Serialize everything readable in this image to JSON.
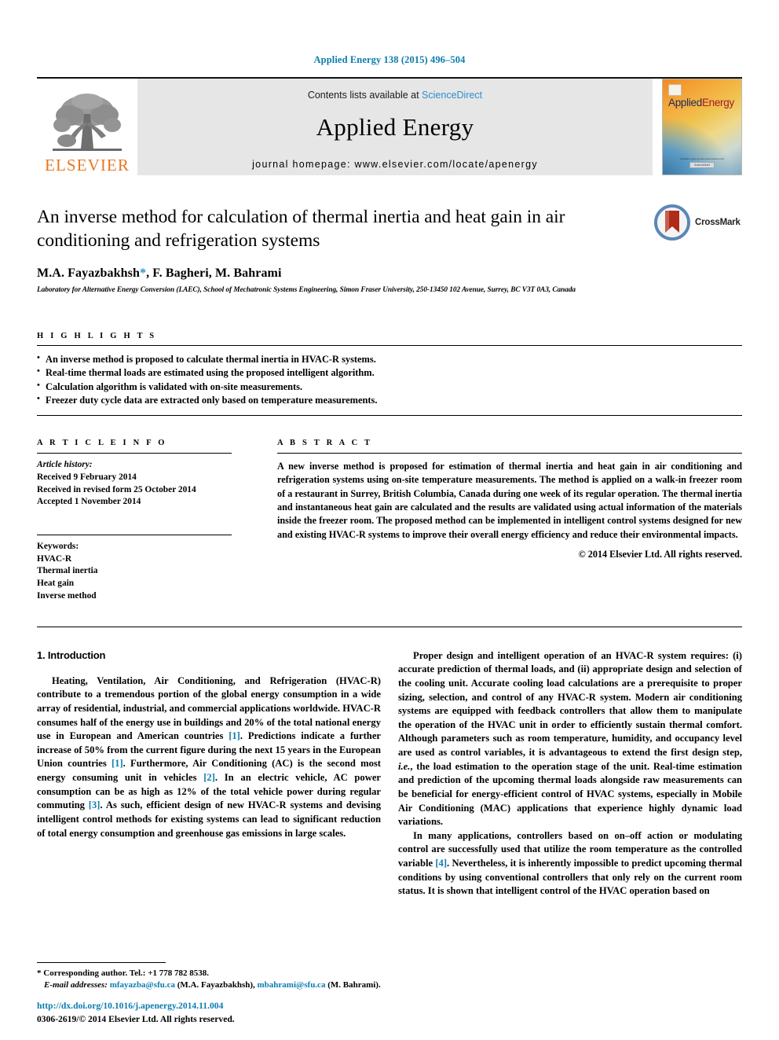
{
  "running_head": "Applied Energy 138 (2015) 496–504",
  "masthead": {
    "publisher_logo_text": "ELSEVIER",
    "contents_prefix": "Contents lists available at ",
    "contents_link": "ScienceDirect",
    "journal_name": "Applied Energy",
    "homepage": "journal homepage: www.elsevier.com/locate/apenergy",
    "cover": {
      "title_part1": "Applied",
      "title_part2": "Energy",
      "footer_caption": "Available online at www.sciencedirect.com",
      "footer_badge": "ScienceDirect"
    }
  },
  "article": {
    "title": "An inverse method for calculation of thermal inertia and heat gain in air conditioning and refrigeration systems",
    "authors": "M.A. Fayazbakhsh",
    "corresponding_marker": "*",
    "authors_rest": ", F. Bagheri, M. Bahrami",
    "affiliation": "Laboratory for Alternative Energy Conversion (LAEC), School of Mechatronic Systems Engineering, Simon Fraser University, 250-13450 102 Avenue, Surrey, BC V3T 0A3, Canada",
    "crossmark_label": "CrossMark"
  },
  "highlights": {
    "heading": "H I G H L I G H T S",
    "items": [
      "An inverse method is proposed to calculate thermal inertia in HVAC-R systems.",
      "Real-time thermal loads are estimated using the proposed intelligent algorithm.",
      "Calculation algorithm is validated with on-site measurements.",
      "Freezer duty cycle data are extracted only based on temperature measurements."
    ]
  },
  "article_info": {
    "heading": "A R T I C L E    I N F O",
    "history_label": "Article history:",
    "history": [
      "Received 9 February 2014",
      "Received in revised form 25 October 2014",
      "Accepted 1 November 2014"
    ],
    "keywords_label": "Keywords:",
    "keywords": [
      "HVAC-R",
      "Thermal inertia",
      "Heat gain",
      "Inverse method"
    ]
  },
  "abstract": {
    "heading": "A B S T R A C T",
    "text": "A new inverse method is proposed for estimation of thermal inertia and heat gain in air conditioning and refrigeration systems using on-site temperature measurements. The method is applied on a walk-in freezer room of a restaurant in Surrey, British Columbia, Canada during one week of its regular operation. The thermal inertia and instantaneous heat gain are calculated and the results are validated using actual information of the materials inside the freezer room. The proposed method can be implemented in intelligent control systems designed for new and existing HVAC-R systems to improve their overall energy efficiency and reduce their environmental impacts.",
    "copyright": "© 2014 Elsevier Ltd. All rights reserved."
  },
  "body": {
    "section_heading": "1. Introduction",
    "left_paragraphs": [
      {
        "segments": [
          {
            "t": "Heating, Ventilation, Air Conditioning, and Refrigeration (HVAC-R) contribute to a tremendous portion of the global energy consumption in a wide array of residential, industrial, and commercial applications worldwide. HVAC-R consumes half of the energy use in buildings and 20% of the total national energy use in European and American countries ",
            "s": "plain"
          },
          {
            "t": "[1]",
            "s": "ref"
          },
          {
            "t": ". Predictions indicate a further increase of 50% from the current figure during the next 15 years in the European Union countries ",
            "s": "plain"
          },
          {
            "t": "[1]",
            "s": "ref"
          },
          {
            "t": ". Furthermore, Air Conditioning (AC) is the second most energy consuming unit in vehicles ",
            "s": "plain"
          },
          {
            "t": "[2]",
            "s": "ref"
          },
          {
            "t": ". In an electric vehicle, AC power consumption can be as high as 12% of the total vehicle power during regular commuting ",
            "s": "plain"
          },
          {
            "t": "[3]",
            "s": "ref"
          },
          {
            "t": ". As such, efficient design of new HVAC-R systems and devising intelligent control methods for existing systems can lead to significant reduction of total energy consumption and greenhouse gas emissions in large scales.",
            "s": "plain"
          }
        ]
      }
    ],
    "right_paragraphs": [
      {
        "segments": [
          {
            "t": "Proper design and intelligent operation of an HVAC-R system requires: (i) accurate prediction of thermal loads, and (ii) appropriate design and selection of the cooling unit. Accurate cooling load calculations are a prerequisite to proper sizing, selection, and control of any HVAC-R system. Modern air conditioning systems are equipped with feedback controllers that allow them to manipulate the operation of the HVAC unit in order to efficiently sustain thermal comfort. Although parameters such as room temperature, humidity, and occupancy level are used as control variables, it is advantageous to extend the first design step, ",
            "s": "plain"
          },
          {
            "t": "i.e.",
            "s": "italic"
          },
          {
            "t": ", the load estimation to the operation stage of the unit. Real-time estimation and prediction of the upcoming thermal loads alongside raw measurements can be beneficial for energy-efficient control of HVAC systems, especially in Mobile Air Conditioning (MAC) applications that experience highly dynamic load variations.",
            "s": "plain"
          }
        ]
      },
      {
        "segments": [
          {
            "t": "In many applications, controllers based on on–off action or modulating control are successfully used that utilize the room temperature as the controlled variable ",
            "s": "plain"
          },
          {
            "t": "[4]",
            "s": "ref"
          },
          {
            "t": ". Nevertheless, it is inherently impossible to predict upcoming thermal conditions by using conventional controllers that only rely on the current room status. It is shown that intelligent control of the HVAC operation based on",
            "s": "plain"
          }
        ]
      }
    ]
  },
  "footnote": {
    "corresponding": "* Corresponding author. Tel.: +1 778 782 8538.",
    "email_label": "E-mail addresses:",
    "email1": "mfayazba@sfu.ca",
    "email1_name": "(M.A. Fayazbakhsh)",
    "email2": "mbahrami@sfu.ca",
    "email2_name": "(M. Bahrami)."
  },
  "doi_block": {
    "doi_url": "http://dx.doi.org/10.1016/j.apenergy.2014.11.004",
    "issn_line": "0306-2619/© 2014 Elsevier Ltd. All rights reserved."
  }
}
